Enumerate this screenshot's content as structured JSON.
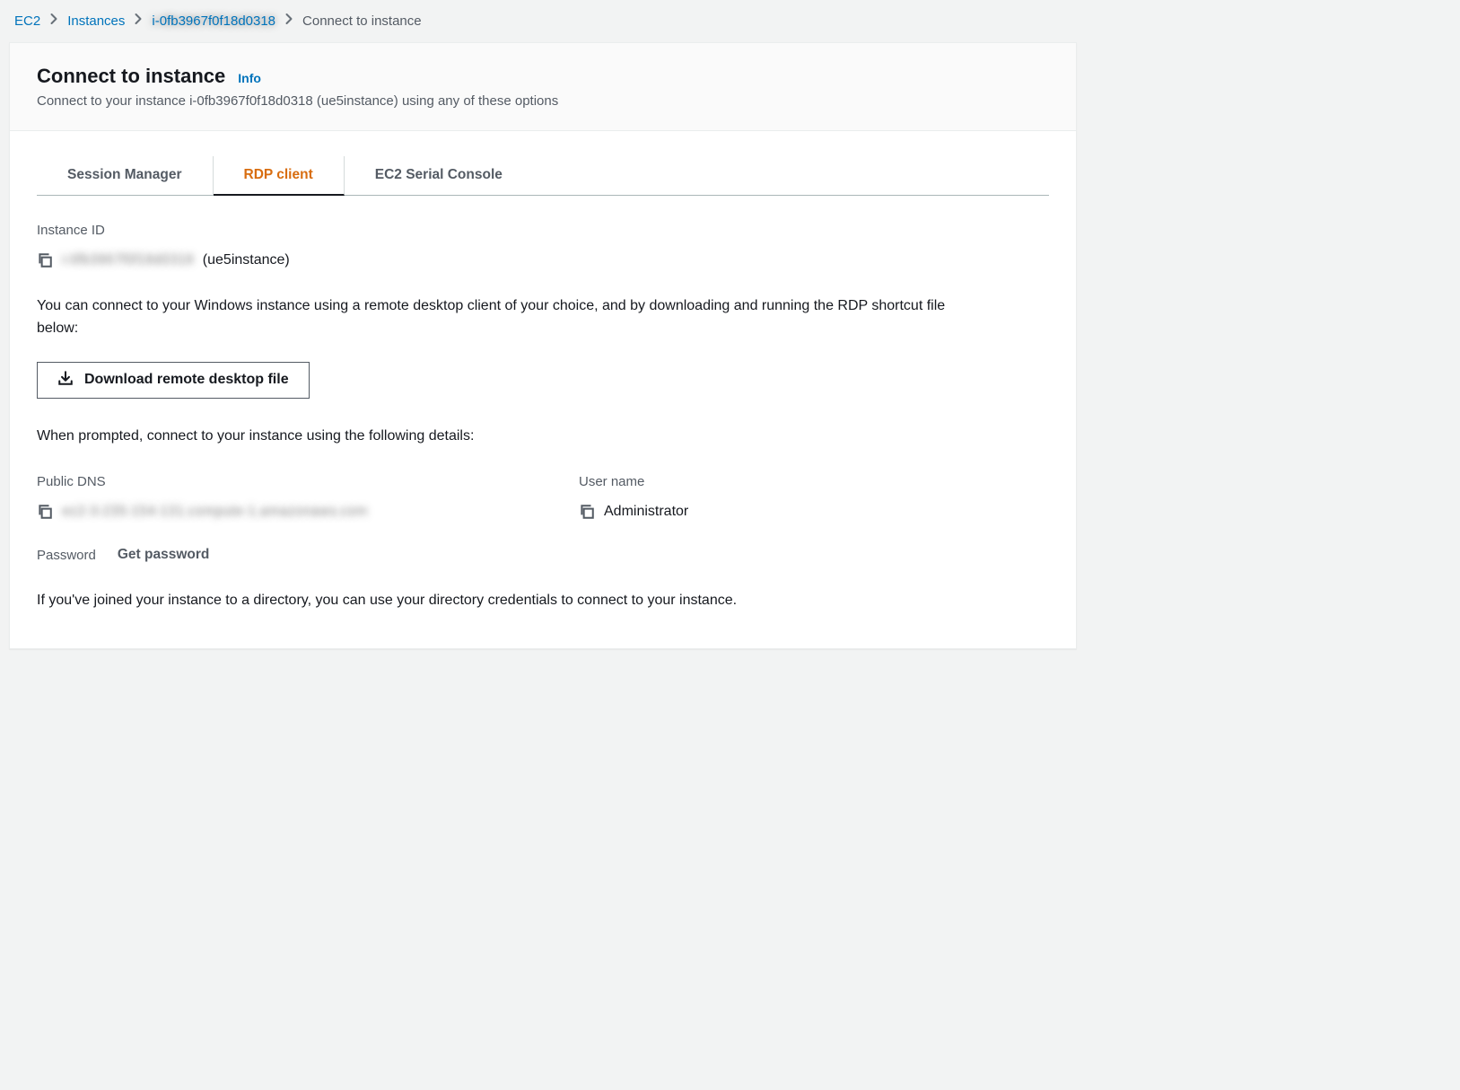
{
  "breadcrumb": {
    "ec2": "EC2",
    "instances": "Instances",
    "instance_id_blurred": "i-0fb3967f0f18d0318",
    "current": "Connect to instance"
  },
  "header": {
    "title": "Connect to instance",
    "info_label": "Info",
    "subtitle": "Connect to your instance i-0fb3967f0f18d0318 (ue5instance) using any of these options"
  },
  "tabs": {
    "session_manager": "Session Manager",
    "rdp_client": "RDP client",
    "serial_console": "EC2 Serial Console"
  },
  "fields": {
    "instance_id_label": "Instance ID",
    "instance_id_value_blurred": "i-0fb3967f0f18d0318",
    "instance_id_name": "(ue5instance)",
    "public_dns_label": "Public DNS",
    "public_dns_value_blurred": "ec2-3-235-154-131.compute-1.amazonaws.com",
    "username_label": "User name",
    "username_value": "Administrator",
    "password_label": "Password",
    "get_password_label": "Get password"
  },
  "text": {
    "explain1": "You can connect to your Windows instance using a remote desktop client of your choice, and by downloading and running the RDP shortcut file below:",
    "download_btn": "Download remote desktop file",
    "explain2": "When prompted, connect to your instance using the following details:",
    "directory_note": "If you've joined your instance to a directory, you can use your directory credentials to connect to your instance."
  }
}
